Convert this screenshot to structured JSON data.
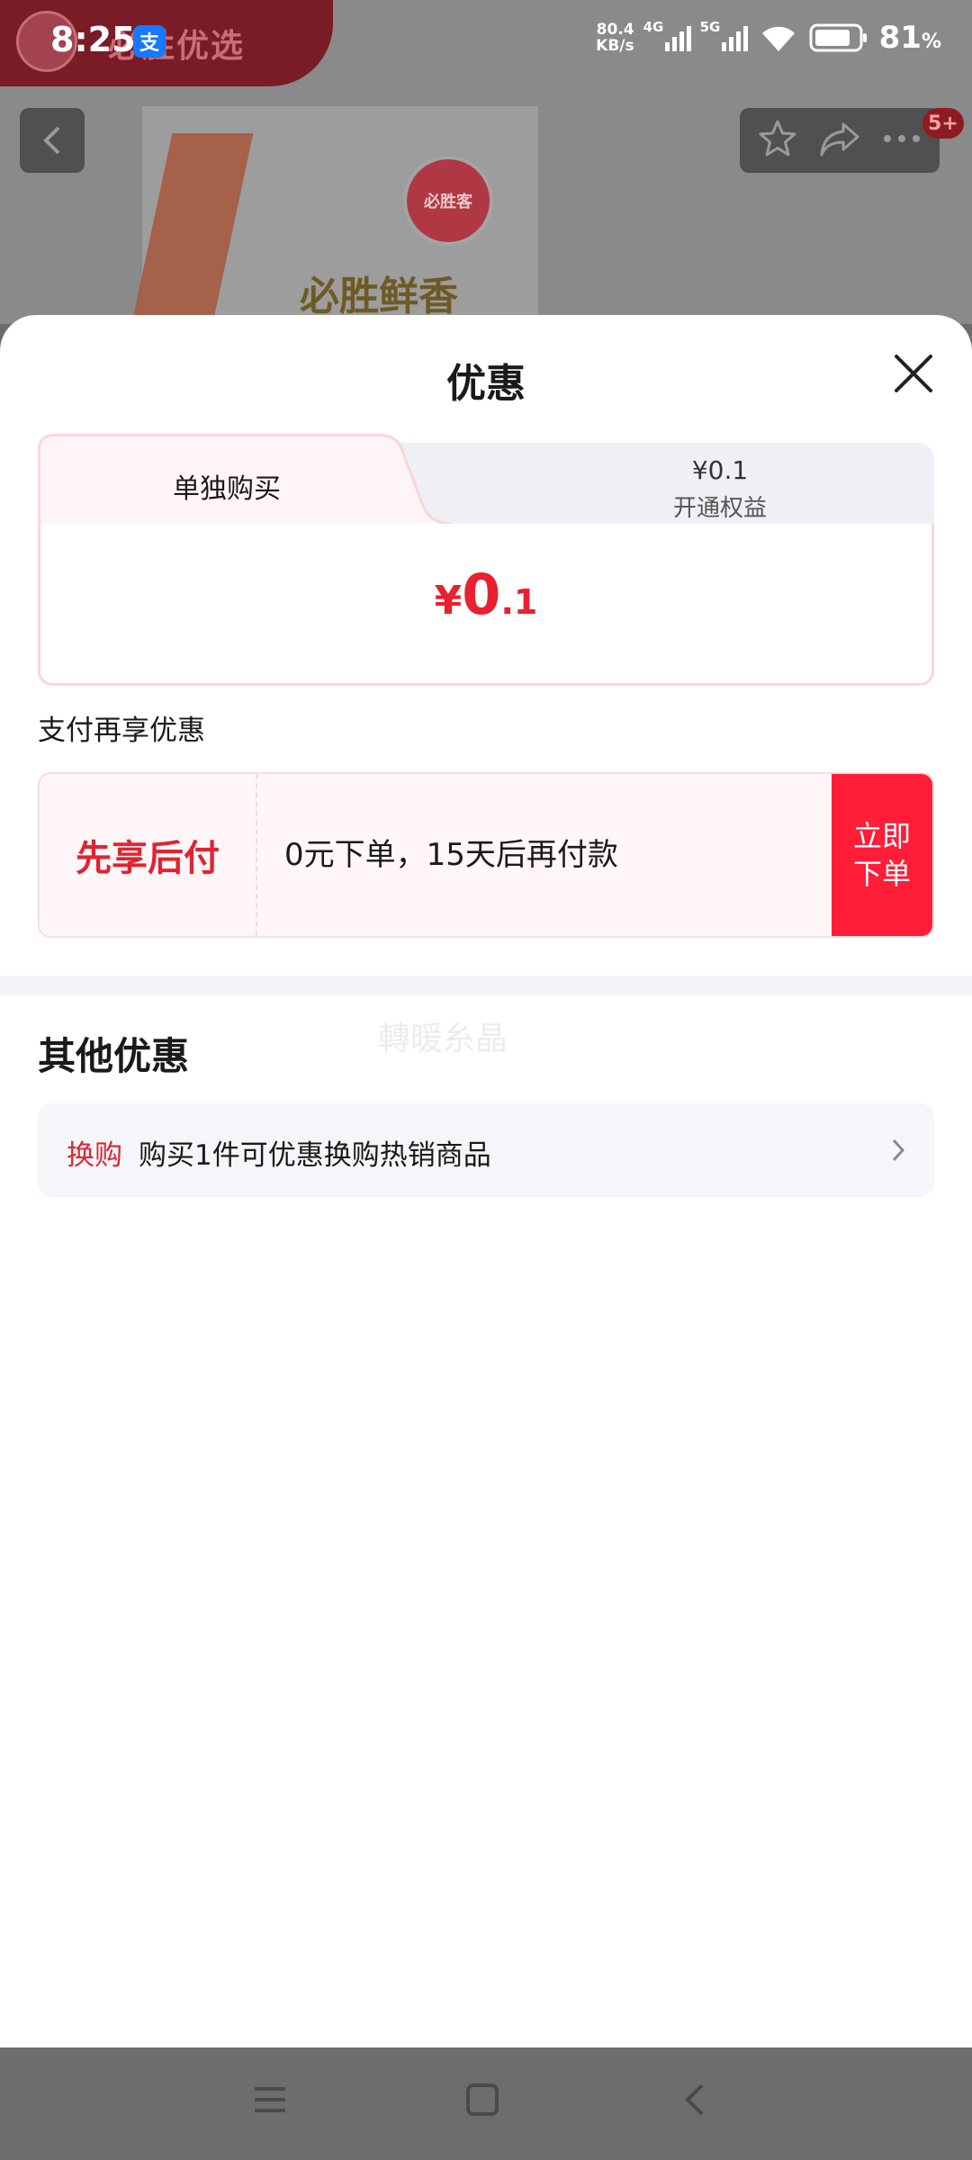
{
  "status_bar": {
    "time": "8:25",
    "app_badge": "支",
    "net_speed_value": "80.4",
    "net_speed_unit": "KB/s",
    "sim1": "4G",
    "sim2": "5G",
    "battery_value": "81",
    "battery_unit": "%"
  },
  "background": {
    "brand_banner": "必胜优选",
    "product_logo": "必胜客",
    "product_title": "必胜鲜香",
    "cart_badge": "5+"
  },
  "sheet": {
    "title": "优惠",
    "tabs": [
      {
        "label": "单独购买"
      },
      {
        "price": "¥0.1",
        "label": "开通权益"
      }
    ],
    "price": {
      "symbol": "¥",
      "integer": "0",
      "decimal": ".1"
    },
    "pay_note": "支付再享优惠",
    "bnpl": {
      "title": "先享后付",
      "description": "0元下单，15天后再付款",
      "button_line1": "立即",
      "button_line2": "下单"
    },
    "watermark": "轉暖糸晶",
    "other_title": "其他优惠",
    "exchange": {
      "tag": "换购",
      "text": "购买1件可优惠换购热销商品"
    }
  },
  "colors": {
    "accent_red": "#e8202f",
    "button_red": "#ff1d37",
    "tab_pink": "#fff5f6",
    "tab_gray": "#eef0f5"
  },
  "icons": [
    "back-icon",
    "star-icon",
    "share-icon",
    "more-icon",
    "close-icon",
    "chevron-right-icon",
    "menu-icon",
    "home-icon",
    "back-nav-icon"
  ]
}
